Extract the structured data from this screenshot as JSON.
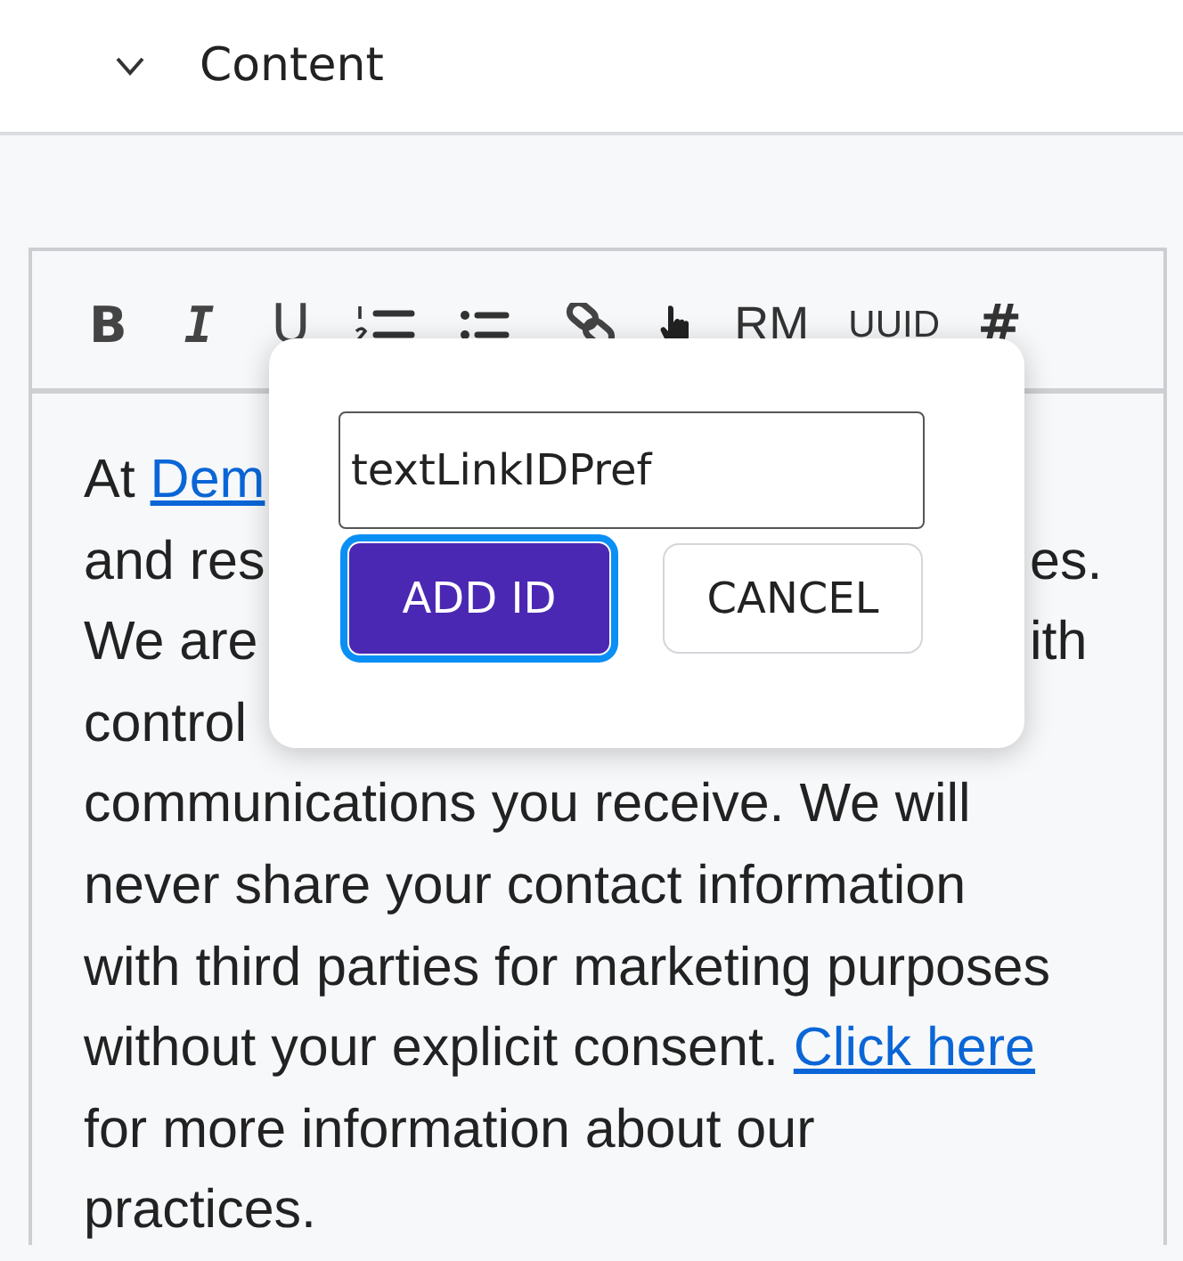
{
  "section": {
    "title": "Content",
    "expanded": true
  },
  "toolbar": [
    {
      "kind": "bold",
      "label": "B"
    },
    {
      "kind": "italic",
      "label": "I"
    },
    {
      "kind": "underline",
      "label": "U"
    },
    {
      "kind": "ordered-list"
    },
    {
      "kind": "bullet-list"
    },
    {
      "kind": "link"
    },
    {
      "kind": "pointer"
    },
    {
      "kind": "text",
      "label": "RM"
    },
    {
      "kind": "text",
      "label": "UUID"
    },
    {
      "kind": "hash",
      "label": "#"
    }
  ],
  "body_lines": [
    {
      "left": [
        {
          "text": "At "
        },
        {
          "text": "Dem",
          "link": true
        }
      ]
    },
    {
      "left": [
        {
          "text": "and res"
        }
      ],
      "right": [
        {
          "text": "es."
        }
      ]
    },
    {
      "left": [
        {
          "text": "We are"
        }
      ],
      "right": [
        {
          "text": "ith"
        }
      ]
    },
    {
      "left": [
        {
          "text": "control"
        }
      ]
    },
    {
      "left": [
        {
          "text": "communications you receive. We will"
        }
      ]
    },
    {
      "left": [
        {
          "text": "never share your contact information"
        }
      ]
    },
    {
      "left": [
        {
          "text": "with third parties for marketing purposes"
        }
      ]
    },
    {
      "left": [
        {
          "text": "without your explicit consent. "
        },
        {
          "text": "Click here",
          "link": true
        }
      ]
    },
    {
      "left": [
        {
          "text": "for more information about our"
        }
      ]
    },
    {
      "left": [
        {
          "text": "practices."
        }
      ]
    }
  ],
  "popup": {
    "input_value": "textLinkIDPref",
    "buttons": [
      {
        "kind": "primary",
        "label": "ADD ID",
        "focused": true
      },
      {
        "kind": "secondary",
        "label": "CANCEL",
        "focused": false
      }
    ]
  }
}
